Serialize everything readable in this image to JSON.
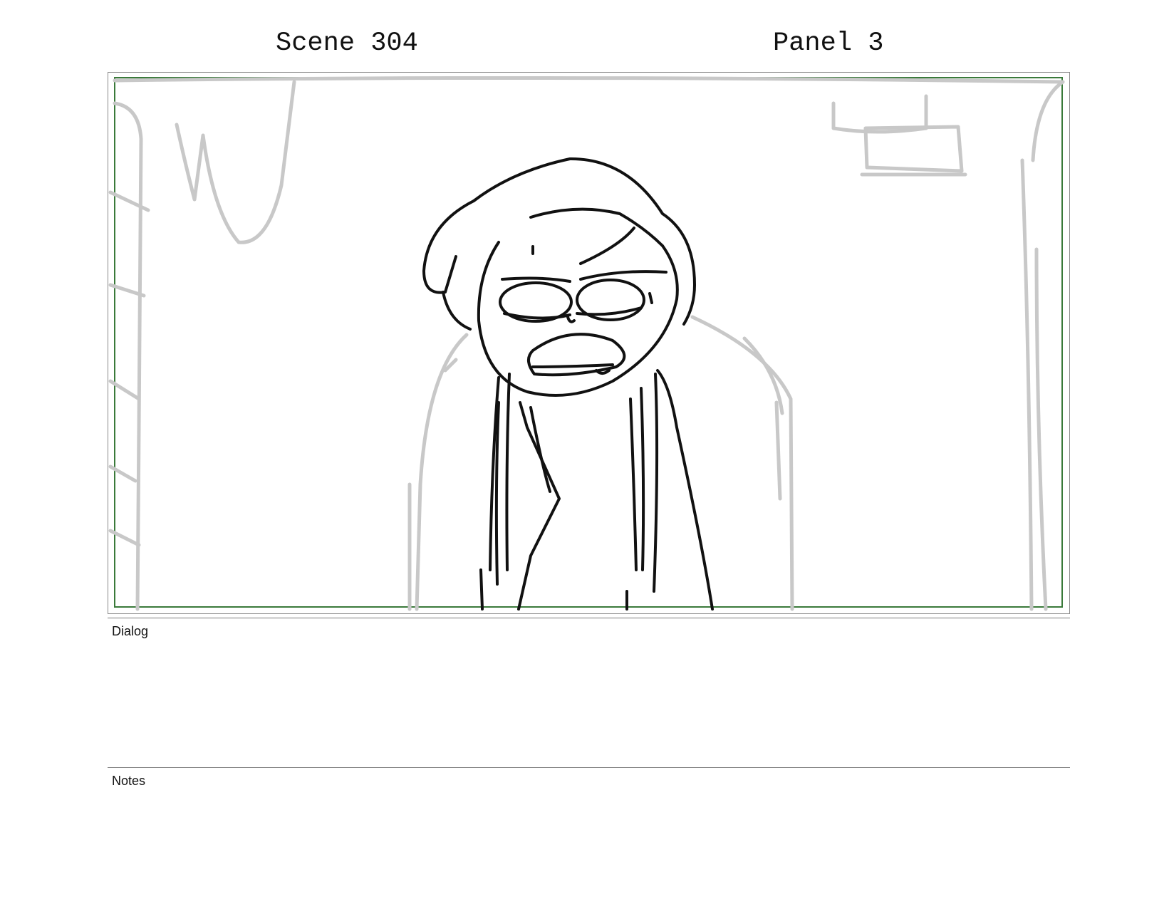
{
  "header": {
    "scene_label": "Scene 304",
    "panel_label": "Panel 3"
  },
  "sections": {
    "dialog_label": "Dialog",
    "notes_label": "Notes"
  },
  "colors": {
    "safe_frame": "#3a7a3a",
    "sketch_background": "#c8c8c8",
    "sketch_character": "#111111"
  }
}
